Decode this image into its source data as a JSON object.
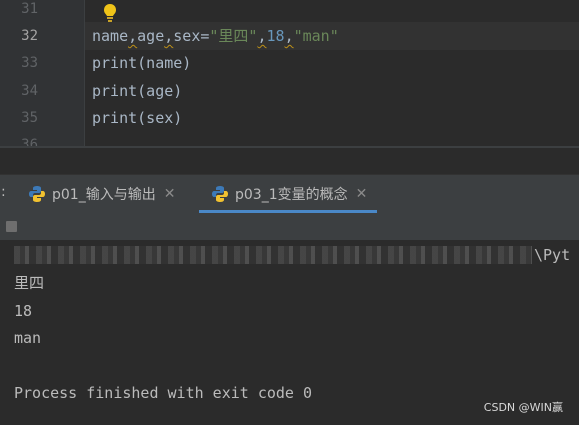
{
  "editor": {
    "line_numbers": [
      "31",
      "32",
      "33",
      "34",
      "35",
      "36"
    ],
    "line32": {
      "p1": "name",
      "comma1": ",",
      "p2": "age",
      "comma2": ",",
      "p3": "sex=",
      "str1": "\"里四\"",
      "comma3": ",",
      "num": "18",
      "comma4": ",",
      "str2": "\"man\""
    },
    "line33": "print(name)",
    "line34": "print(age)",
    "line35": "print(sex)"
  },
  "run_tabs": {
    "colon": ":",
    "tabs": [
      {
        "label": "p01_输入与输出",
        "close": "✕"
      },
      {
        "label": "p03_1变量的概念",
        "close": "✕"
      }
    ]
  },
  "console": {
    "path_tail": "\\Pyt",
    "output_lines": [
      "里四",
      "18",
      "man"
    ],
    "exit_message": "Process finished with exit code 0"
  },
  "watermark": "CSDN @WIN赢",
  "colors": {
    "background": "#2b2b2b",
    "string": "#6a8759",
    "number": "#6897bb",
    "bulb": "#f0c419",
    "tab_underline": "#4a88c7"
  }
}
